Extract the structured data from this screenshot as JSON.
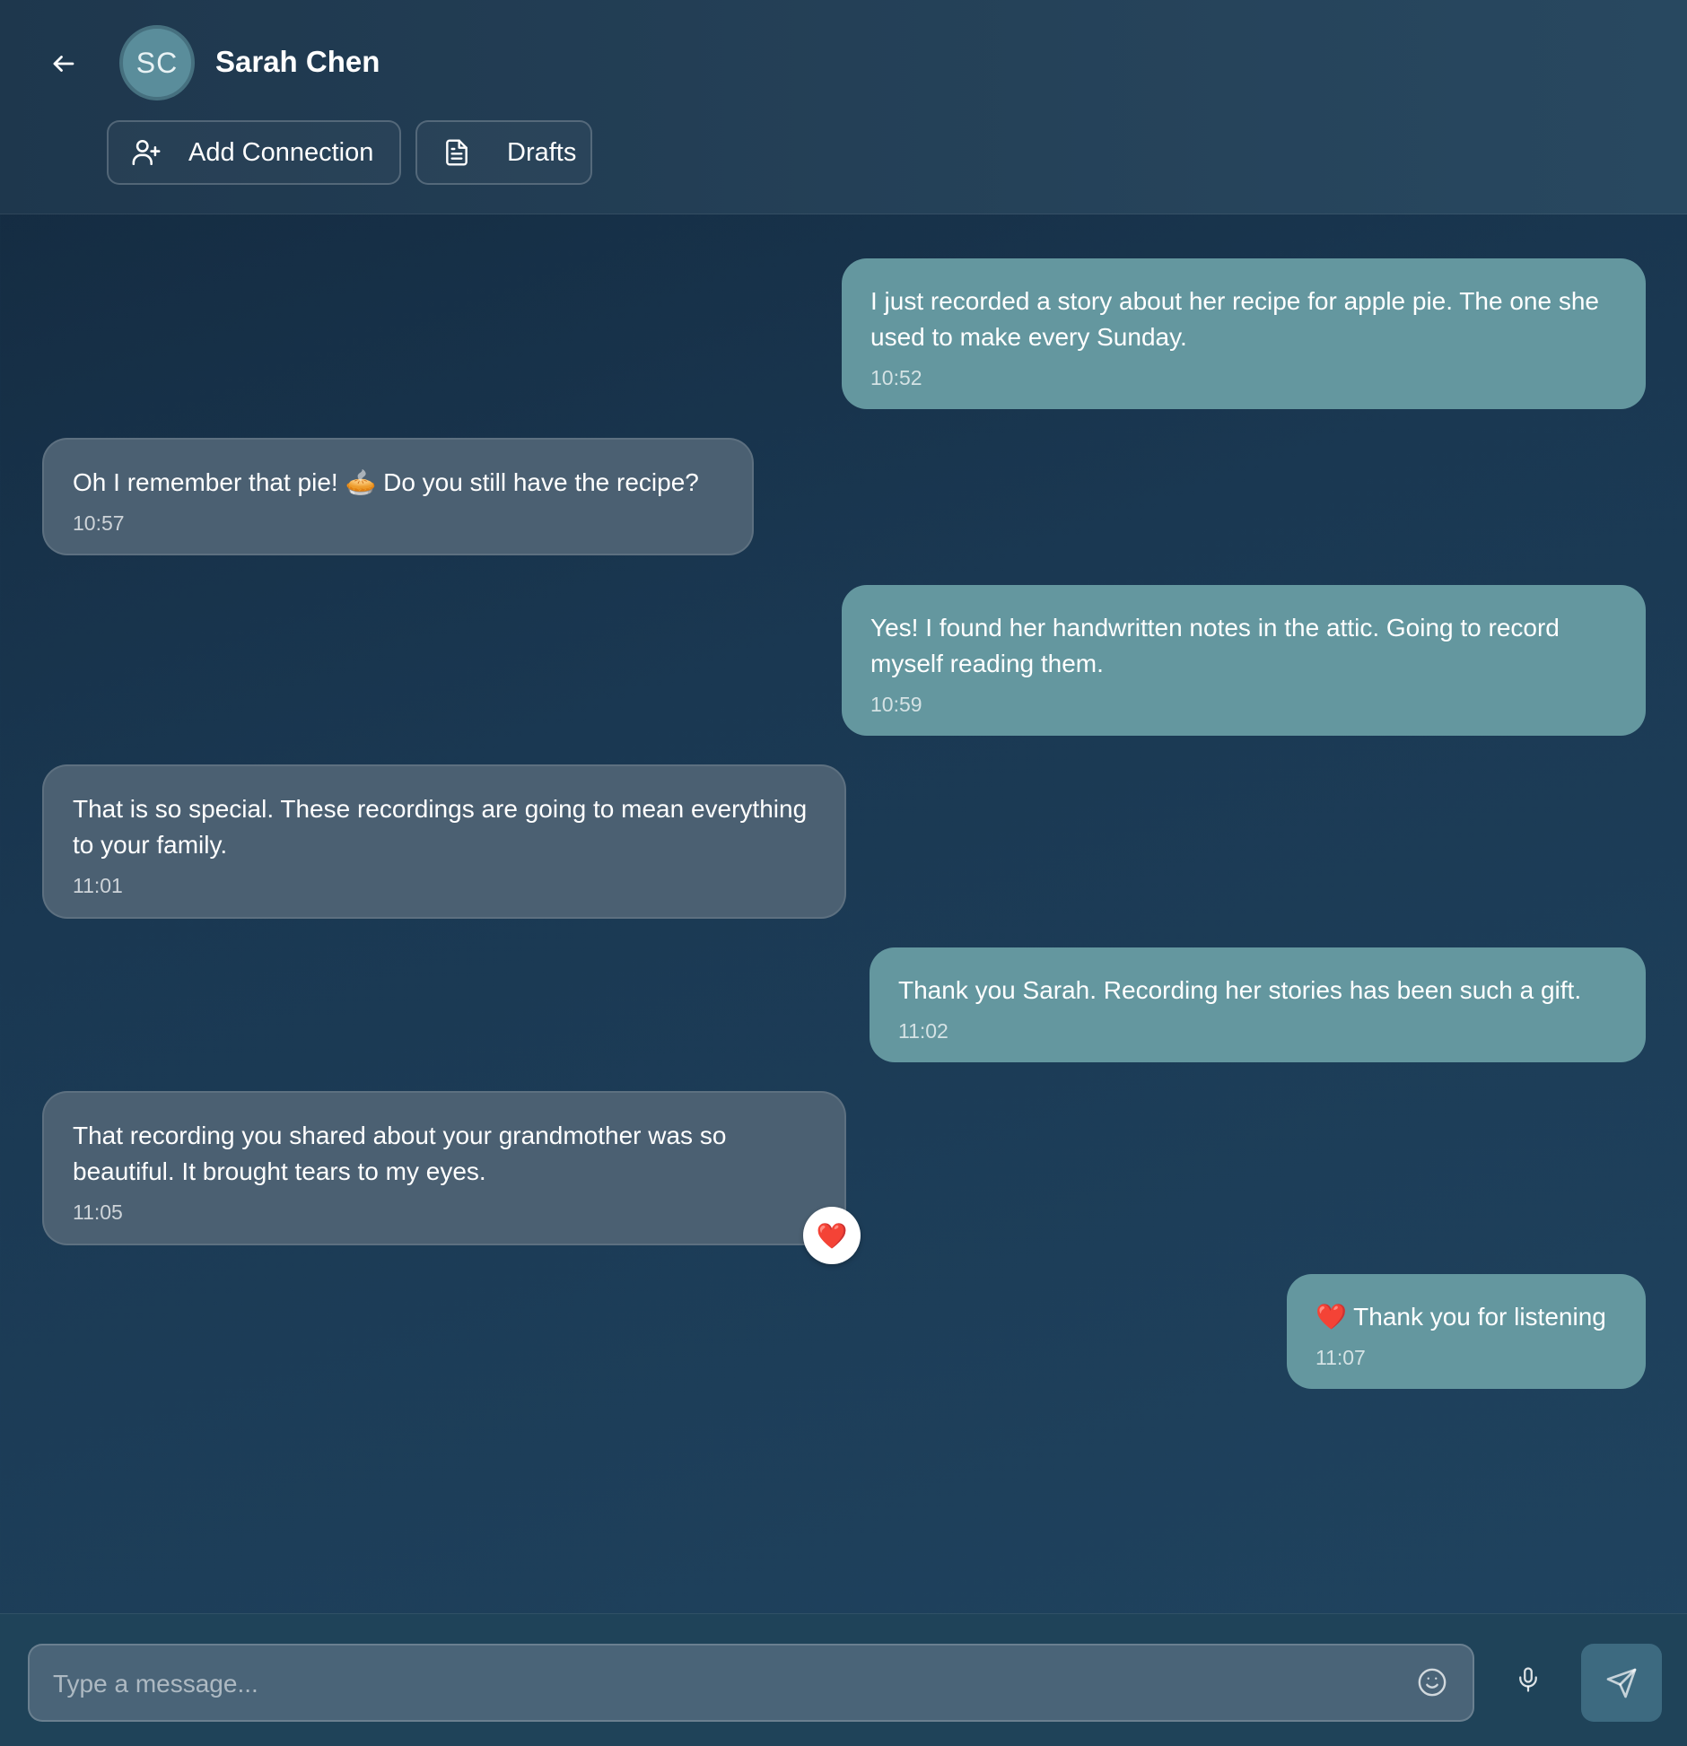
{
  "header": {
    "avatar_initials": "SC",
    "contact_name": "Sarah Chen",
    "add_connection_label": "Add Connection",
    "drafts_label": "Drafts",
    "icons": {
      "back": "arrow-left-icon",
      "add_connection": "user-plus-icon",
      "drafts": "document-icon"
    }
  },
  "messages": [
    {
      "direction": "sent",
      "text": "I just recorded a story about her recipe for apple pie. The one she used to make every Sunday.",
      "time": "10:52"
    },
    {
      "direction": "received",
      "text": "Oh I remember that pie! 🥧 Do you still have the recipe?",
      "time": "10:57"
    },
    {
      "direction": "sent",
      "text": "Yes! I found her handwritten notes in the attic. Going to record myself reading them.",
      "time": "10:59"
    },
    {
      "direction": "received",
      "text": "That is so special. These recordings are going to mean everything to your family.",
      "time": "11:01"
    },
    {
      "direction": "sent",
      "text": "Thank you Sarah. Recording her stories has been such a gift.",
      "time": "11:02"
    },
    {
      "direction": "received",
      "text": "That recording you shared about your grandmother was so beautiful. It brought tears to my eyes.",
      "time": "11:05",
      "reaction": "❤️"
    },
    {
      "direction": "sent",
      "text": "❤️ Thank you for listening",
      "time": "11:07"
    }
  ],
  "composer": {
    "placeholder": "Type a message...",
    "value": "",
    "icons": {
      "emoji": "smiley-icon",
      "mic": "microphone-icon",
      "send": "send-icon"
    }
  },
  "colors": {
    "sent_bubble": "#64979f",
    "received_bubble": "#4b6072",
    "background": "#1a3852",
    "send_button": "#3d6a80"
  }
}
